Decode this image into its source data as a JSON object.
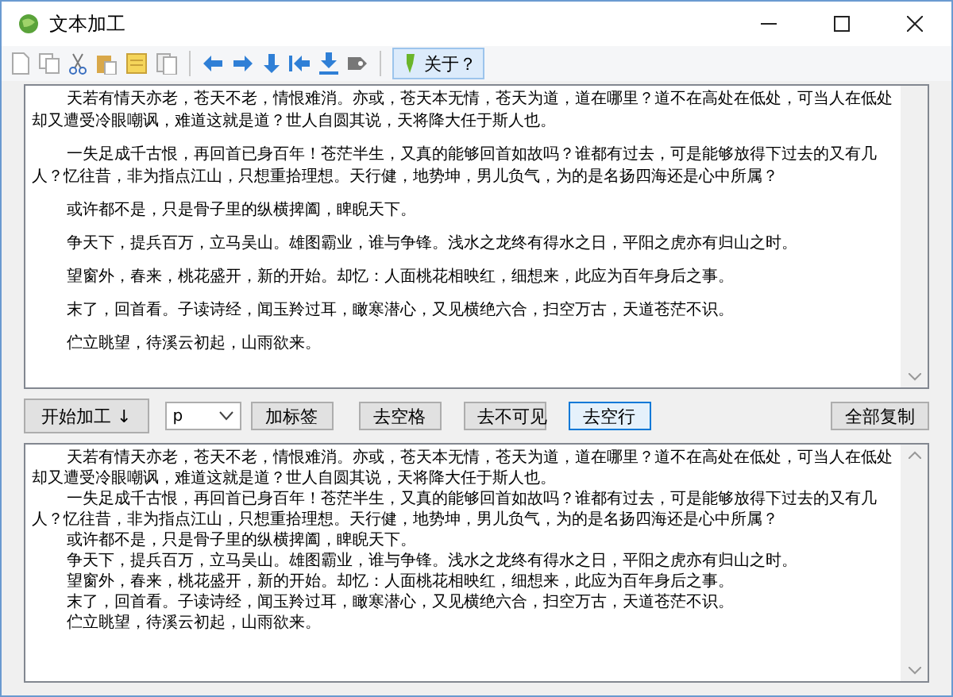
{
  "window": {
    "title": "文本加工"
  },
  "toolbar": {
    "about_label": "关于？"
  },
  "source_text": {
    "paragraphs": [
      {
        "text": "天若有情天亦老，苍天不老，情恨难消。亦或，苍天本无情，苍天为道，道在哪里？道不在高处在低处，可当人在低处却又遭受冷眼嘲讽，难道这就是道？世人自圆其说，天将降大任于斯人也。"
      },
      {
        "text": "一失足成千古恨，再回首已身百年！苍茫半生，又真的能够回首如故吗？谁都有过去，可是能够放得下过去的又有几人？忆往昔，非为指点江山，只想重拾理想。天行健，地势坤，男儿负气，为的是名扬四海还是心中所属？"
      },
      {
        "text": "或许都不是，只是骨子里的纵横捭阖，睥睨天下。"
      },
      {
        "text": "争天下，提兵百万，立马吴山。雄图霸业，谁与争锋。浅水之龙终有得水之日，平阳之虎亦有归山之时。"
      },
      {
        "text": "望窗外，春来，桃花盛开，新的开始。却忆：人面桃花相映红，细想来，此应为百年身后之事。"
      },
      {
        "text": "末了，回首看。子读诗经，闻玉羚过耳，瞰寒潜心，又见横绝六合，扫空万古，天道苍茫不识。"
      },
      {
        "text": "伫立眺望，待溪云初起，山雨欲来。"
      }
    ]
  },
  "controls": {
    "start_button": "开始加工 ↓",
    "tag_select": "p",
    "buttons": [
      {
        "label": "加标签",
        "focused": false
      },
      {
        "label": "去空格",
        "focused": false
      },
      {
        "label": "去不可见",
        "focused": false
      },
      {
        "label": "去空行",
        "focused": true
      }
    ],
    "copy_all_button": "全部复制"
  },
  "output_text": {
    "paragraphs": [
      "天若有情天亦老，苍天不老，情恨难消。亦或，苍天本无情，苍天为道，道在哪里？道不在高处在低处，可当人在低处却又遭受冷眼嘲讽，难道这就是道？世人自圆其说，天将降大任于斯人也。",
      "一失足成千古恨，再回首已身百年！苍茫半生，又真的能够回首如故吗？谁都有过去，可是能够放得下过去的又有几人？忆往昔，非为指点江山，只想重拾理想。天行健，地势坤，男儿负气，为的是名扬四海还是心中所属？",
      "或许都不是，只是骨子里的纵横捭阖，睥睨天下。",
      "争天下，提兵百万，立马吴山。雄图霸业，谁与争锋。浅水之龙终有得水之日，平阳之虎亦有归山之时。",
      "望窗外，春来，桃花盛开，新的开始。却忆：人面桃花相映红，细想来，此应为百年身后之事。",
      "末了，回首看。子读诗经，闻玉羚过耳，瞰寒潜心，又见横绝六合，扫空万古，天道苍茫不识。",
      "伫立眺望，待溪云初起，山雨欲来。"
    ]
  }
}
